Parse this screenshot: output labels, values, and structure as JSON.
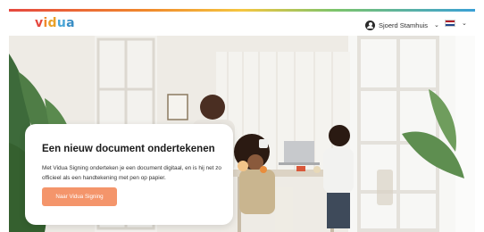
{
  "header": {
    "logo": [
      "v",
      "i",
      "d",
      "u",
      "a"
    ],
    "user_name": "Sjoerd Stamhuis",
    "user_chevron": "⌄",
    "lang_chevron": "⌄",
    "flag_colors": [
      "#ae1c28",
      "#ffffff",
      "#21468b"
    ]
  },
  "hero": {
    "title": "Een nieuw document ondertekenen",
    "description": "Met Vidua Signing onderteken je een document digitaal, en is hij net zo officieel als een handtekening met pen op papier.",
    "cta_label": "Naar Vidua Signing"
  },
  "colors": {
    "accent": "#f4956b",
    "stripe": [
      "#e5483f",
      "#f08a2c",
      "#f5c640",
      "#7cc46b",
      "#3aa0d6"
    ]
  }
}
